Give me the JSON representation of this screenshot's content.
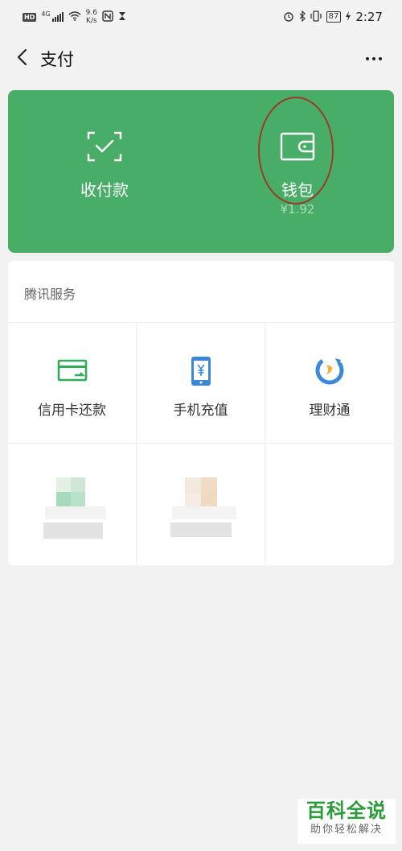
{
  "status_bar": {
    "hd": "HD",
    "network": "4G",
    "speed_top": "9.6",
    "speed_bottom": "K/s",
    "battery": "87",
    "time": "2:27"
  },
  "header": {
    "title": "支付",
    "back_icon": "chevron-left-icon",
    "more_icon": "more-dots-icon"
  },
  "pay_card": {
    "color": "#47ad67",
    "receive": {
      "label": "收付款",
      "icon": "scan-check-icon"
    },
    "wallet": {
      "label": "钱包",
      "balance": "¥1.92",
      "icon": "wallet-icon"
    }
  },
  "services": {
    "title": "腾讯服务",
    "items": [
      {
        "label": "信用卡还款",
        "icon": "credit-card-icon"
      },
      {
        "label": "手机充值",
        "icon": "phone-yuan-icon"
      },
      {
        "label": "理财通",
        "icon": "licaitong-icon"
      }
    ]
  },
  "watermark": {
    "title": "百科全说",
    "subtitle": "助你轻松解决"
  }
}
